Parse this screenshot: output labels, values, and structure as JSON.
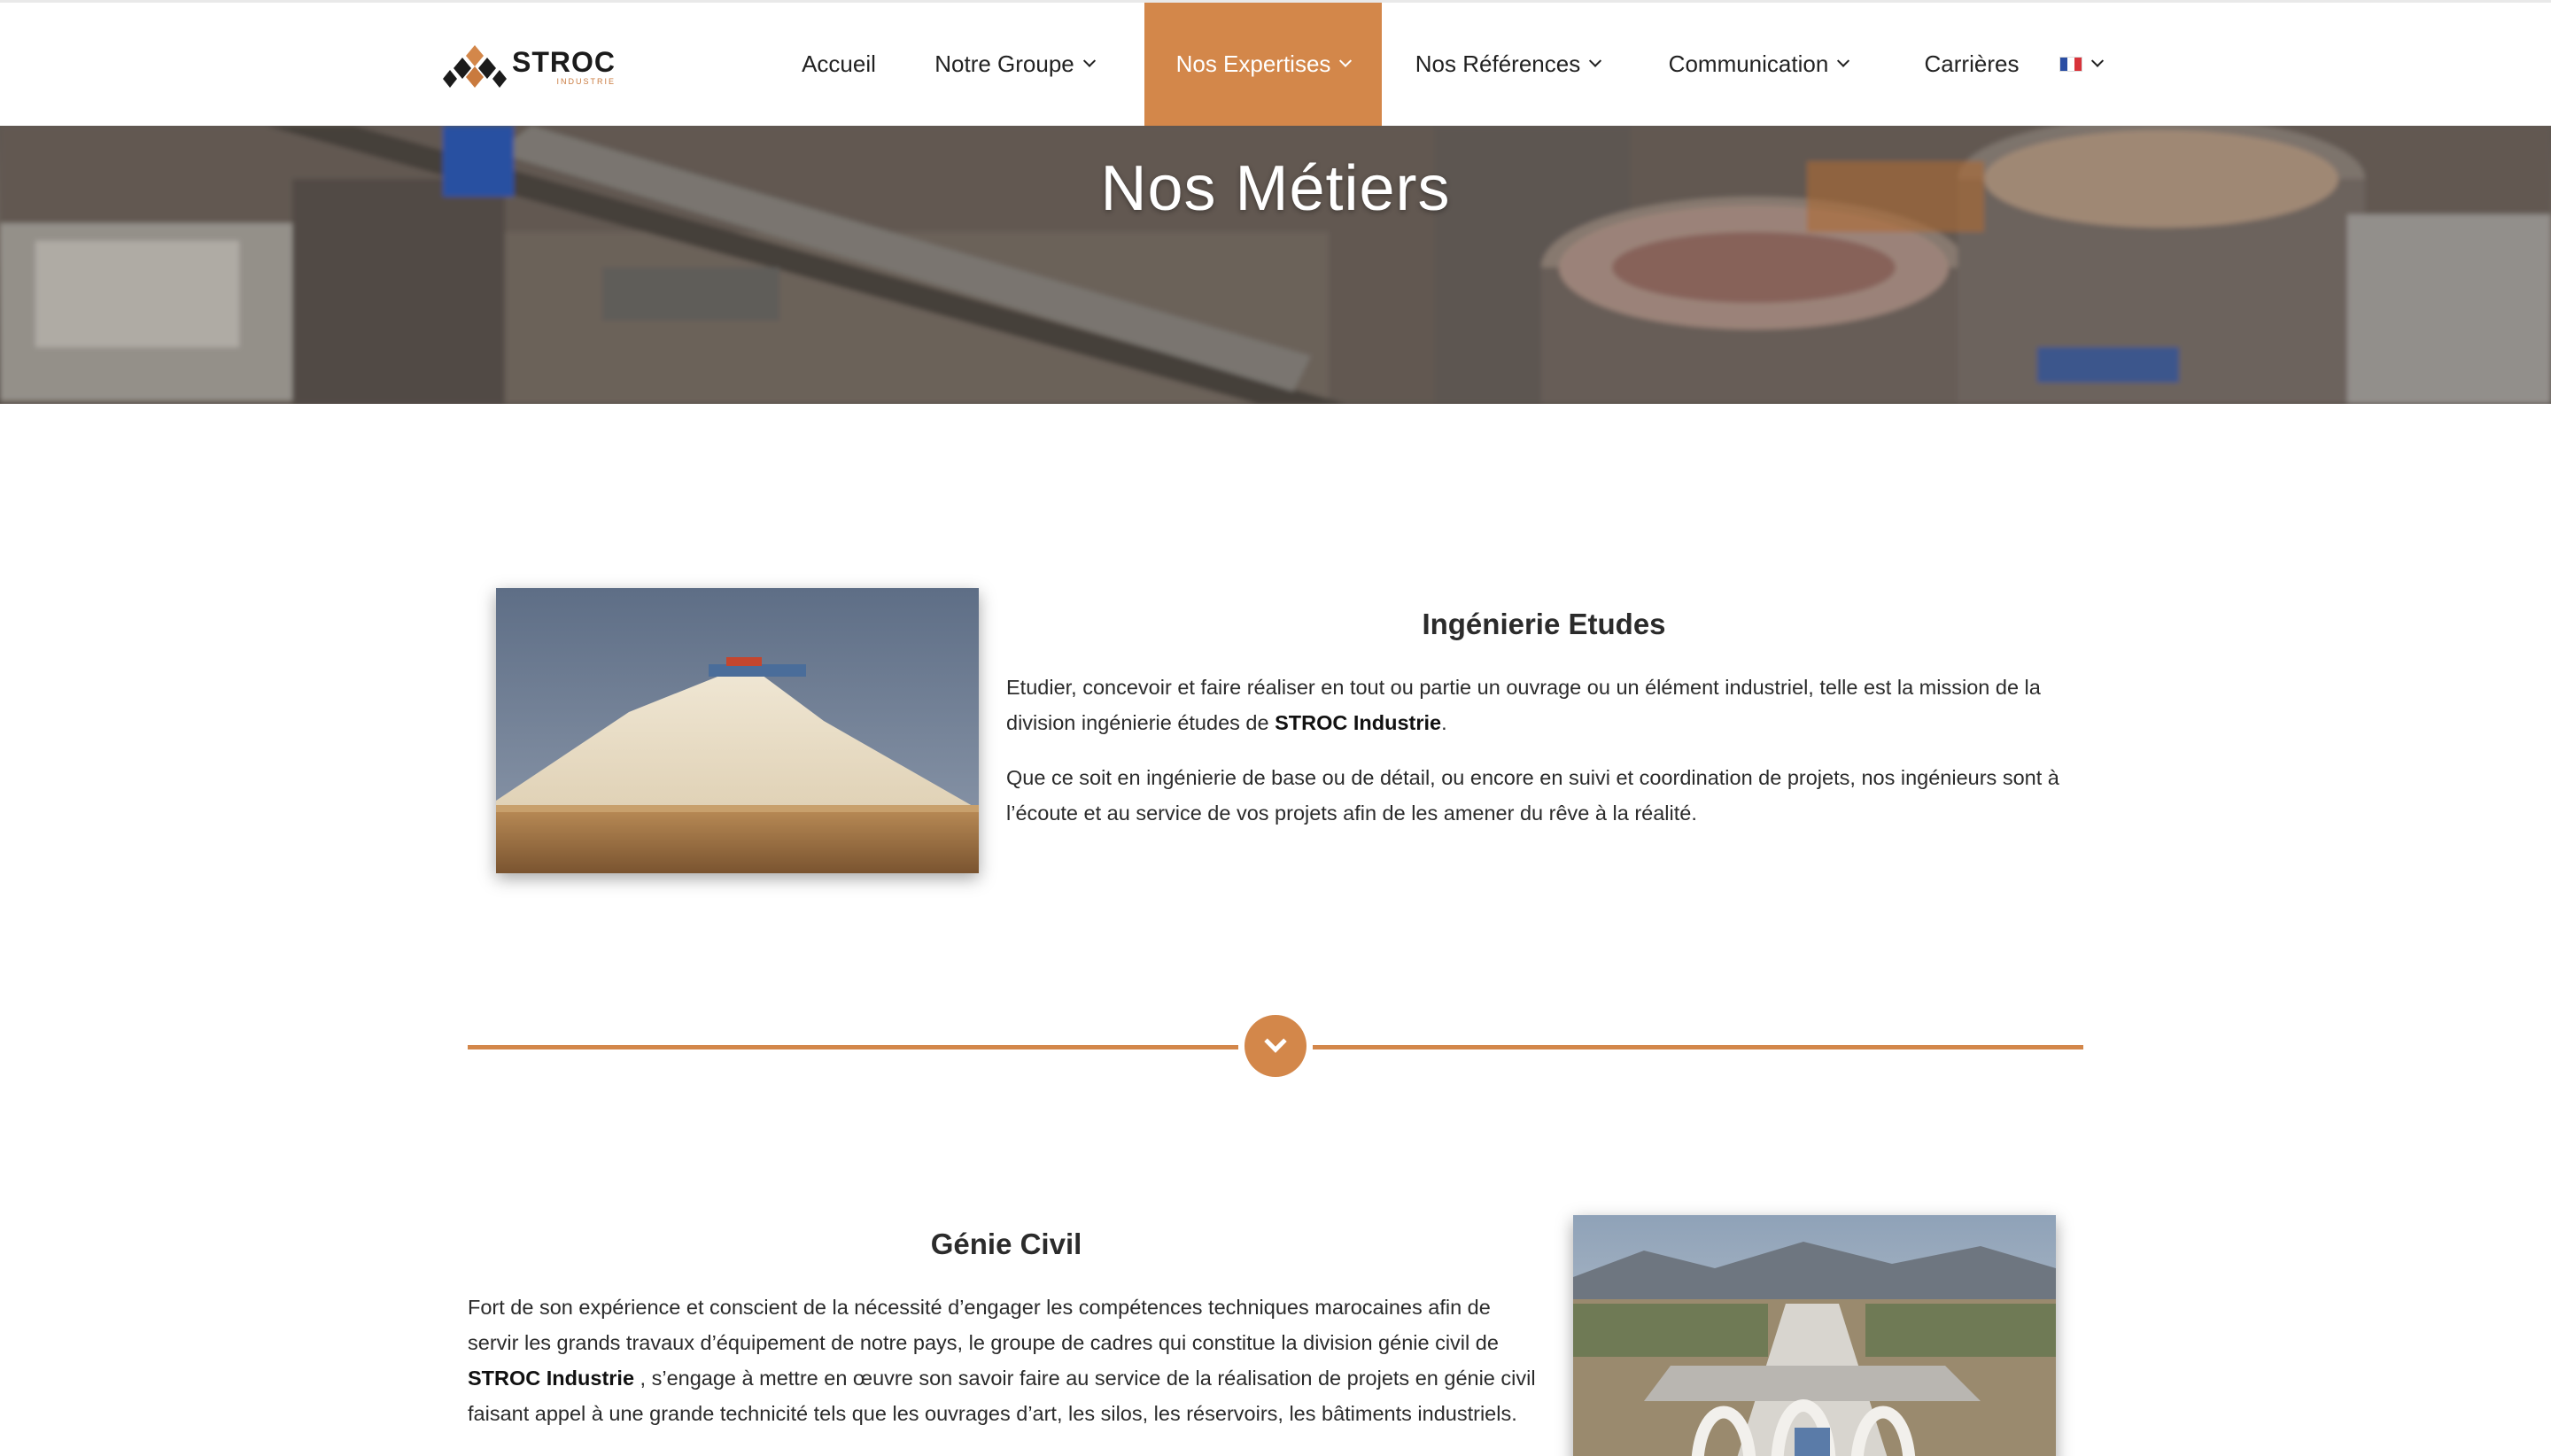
{
  "header": {
    "logo_name": "STROC",
    "logo_sub": "INDUSTRIE",
    "nav": [
      {
        "label": "Accueil",
        "dropdown": false,
        "active": false
      },
      {
        "label": "Notre Groupe",
        "dropdown": true,
        "active": false
      },
      {
        "label": "Nos Expertises",
        "dropdown": true,
        "active": true
      },
      {
        "label": "Nos Références",
        "dropdown": true,
        "active": false
      },
      {
        "label": "Communication",
        "dropdown": true,
        "active": false
      },
      {
        "label": "Carrières",
        "dropdown": false,
        "active": false
      }
    ],
    "language": "fr-flag-icon"
  },
  "hero": {
    "title": "Nos Métiers"
  },
  "sections": [
    {
      "title": "Ingénierie Etudes",
      "paragraphs": [
        {
          "before": "Etudier, concevoir et faire réaliser en tout ou partie un ouvrage ou un élément industriel, telle est la mission de la division ingénierie études de ",
          "bold": "STROC Industrie",
          "after": "."
        },
        {
          "before": "Que ce soit en ingénierie de base ou de détail, ou encore en suivi et coordination de projets, nos ingénieurs sont à l’écoute et au service de vos projets afin de les amener du rêve à la réalité.",
          "bold": "",
          "after": ""
        }
      ]
    },
    {
      "title": "Génie Civil",
      "paragraphs": [
        {
          "before": "Fort de son expérience et conscient de la nécessité d’engager les compétences techniques marocaines afin de servir les grands travaux d’équipement de notre pays, le groupe de cadres qui constitue la division génie civil de ",
          "bold": "STROC Industrie",
          "after": " , s’engage à mettre en œuvre son savoir faire au service de la réalisation de projets en génie civil faisant appel à une grande technicité tels que les ouvrages d’art, les silos, les réservoirs, les bâtiments industriels."
        }
      ]
    }
  ],
  "colors": {
    "accent": "#d3874a",
    "text": "#2b2b2b",
    "header_bg": "#ffffff"
  }
}
